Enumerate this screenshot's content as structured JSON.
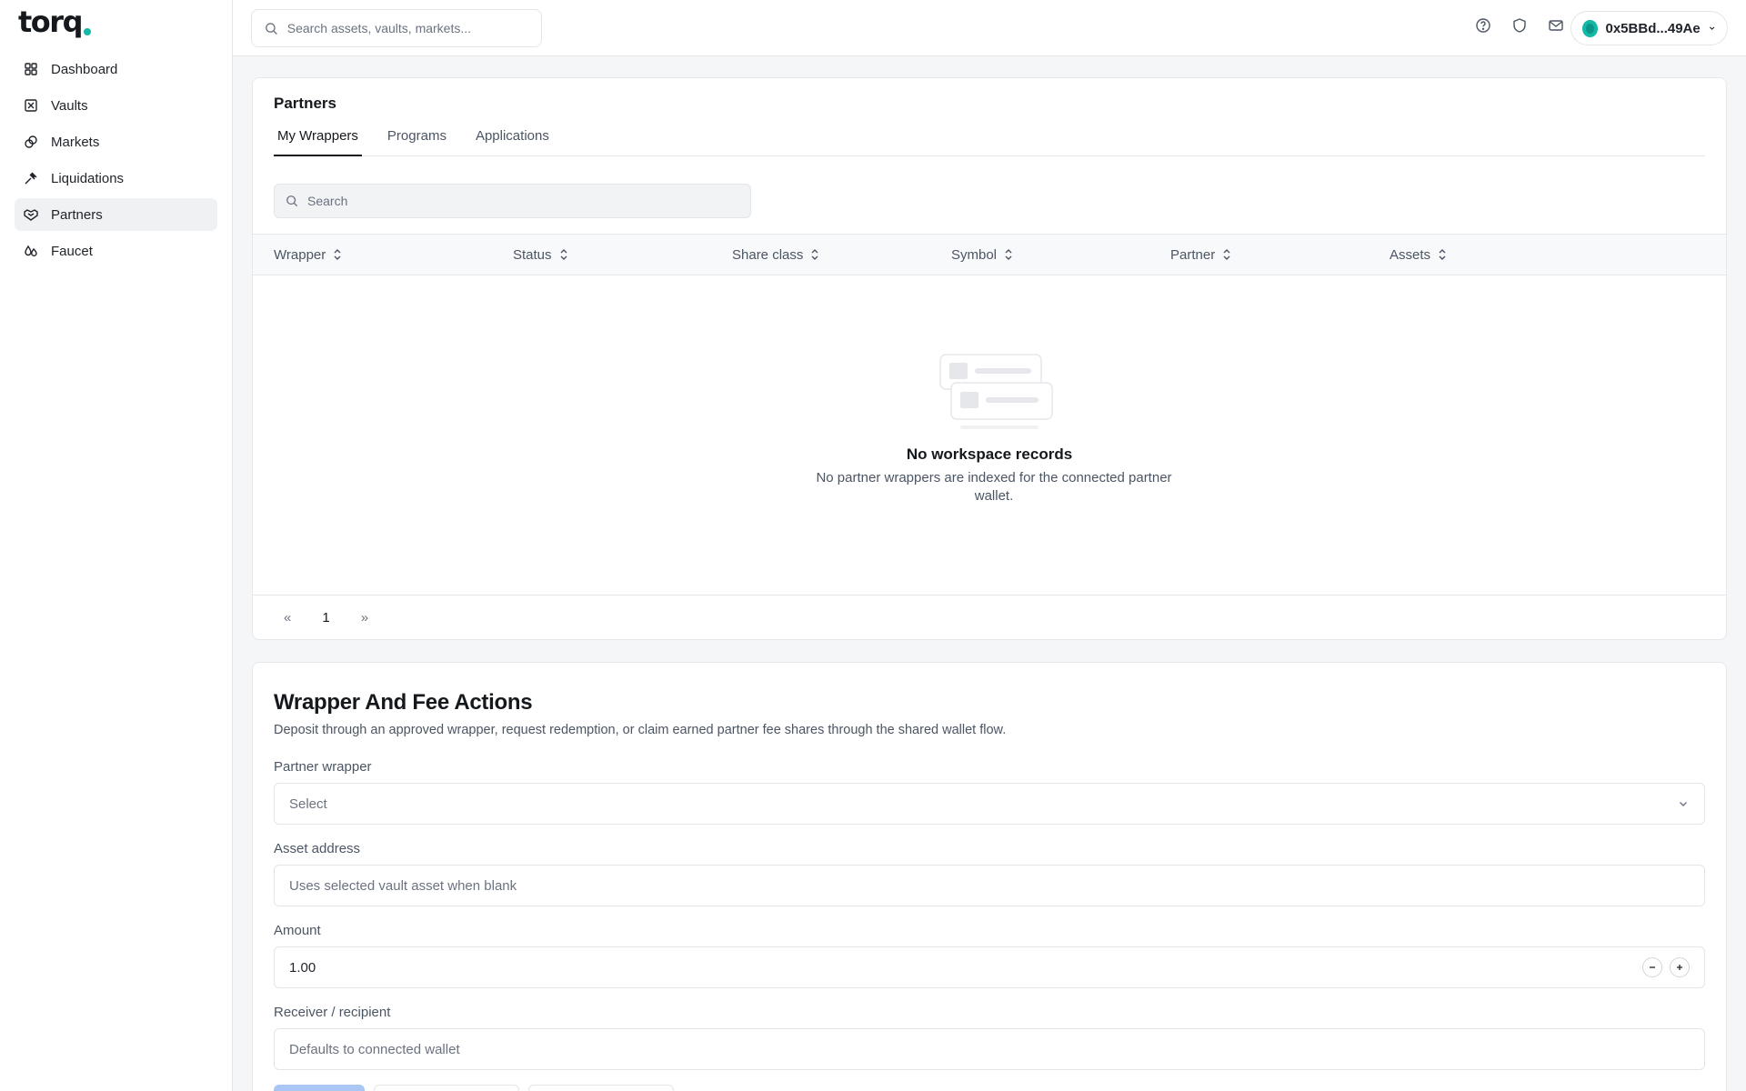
{
  "brand": {
    "logo_text": "torq"
  },
  "sidebar": {
    "items": [
      {
        "label": "Dashboard",
        "icon": "grid-icon"
      },
      {
        "label": "Vaults",
        "icon": "vault-icon"
      },
      {
        "label": "Markets",
        "icon": "coins-icon"
      },
      {
        "label": "Liquidations",
        "icon": "gavel-icon"
      },
      {
        "label": "Partners",
        "icon": "handshake-icon",
        "active": true
      },
      {
        "label": "Faucet",
        "icon": "droplets-icon"
      }
    ]
  },
  "topbar": {
    "search_placeholder": "Search assets, vaults, markets...",
    "icons": [
      "help-icon",
      "shield-icon",
      "mail-icon"
    ],
    "wallet_address": "0x5BBd...49Ae"
  },
  "partners": {
    "title": "Partners",
    "tabs": [
      {
        "label": "My Wrappers",
        "active": true
      },
      {
        "label": "Programs"
      },
      {
        "label": "Applications"
      }
    ],
    "search_placeholder": "Search",
    "columns": [
      "Wrapper",
      "Status",
      "Share class",
      "Symbol",
      "Partner",
      "Assets"
    ],
    "empty_title": "No workspace records",
    "empty_desc": "No partner wrappers are indexed for the connected partner wallet.",
    "pagination": {
      "prev": "«",
      "page": "1",
      "next": "»"
    }
  },
  "actions": {
    "title": "Wrapper And Fee Actions",
    "description": "Deposit through an approved wrapper, request redemption, or claim earned partner fee shares through the shared wallet flow.",
    "partner_wrapper_label": "Partner wrapper",
    "partner_wrapper_placeholder": "Select",
    "asset_address_label": "Asset address",
    "asset_address_placeholder": "Uses selected vault asset when blank",
    "amount_label": "Amount",
    "amount_value": "1.00",
    "receiver_label": "Receiver / recipient",
    "receiver_placeholder": "Defaults to connected wallet"
  },
  "colors": {
    "accent": "#14b8a6",
    "primary_button": "#a9c6f5"
  }
}
